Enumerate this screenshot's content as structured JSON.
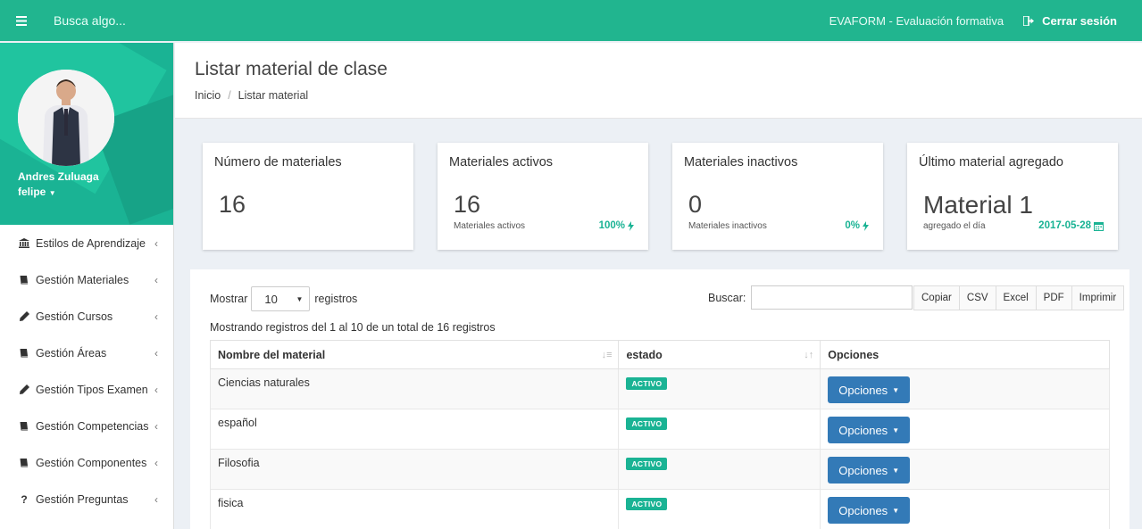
{
  "topbar": {
    "search_placeholder": "Busca algo...",
    "app_title": "EVAFORM - Evaluación formativa",
    "logout_label": "Cerrar sesión"
  },
  "profile": {
    "name": "Andres Zuluaga",
    "username": "felipe"
  },
  "sidebar": {
    "items": [
      {
        "label": "Estilos de Aprendizaje",
        "icon": "bank-icon"
      },
      {
        "label": "Gestión Materiales",
        "icon": "book-icon"
      },
      {
        "label": "Gestión Cursos",
        "icon": "pencil-icon"
      },
      {
        "label": "Gestión Áreas",
        "icon": "book-icon"
      },
      {
        "label": "Gestión Tipos Examen",
        "icon": "pencil-icon"
      },
      {
        "label": "Gestión Competencias",
        "icon": "book-icon"
      },
      {
        "label": "Gestión Componentes",
        "icon": "book-icon"
      },
      {
        "label": "Gestión Preguntas",
        "icon": "question-icon"
      }
    ]
  },
  "header": {
    "title": "Listar material de clase",
    "breadcrumb": [
      "Inicio",
      "Listar material"
    ]
  },
  "cards": [
    {
      "title": "Número de materiales",
      "value": "16"
    },
    {
      "title": "Materiales activos",
      "value": "16",
      "sub": "Materiales activos",
      "pct": "100%"
    },
    {
      "title": "Materiales inactivos",
      "value": "0",
      "sub": "Materiales inactivos",
      "pct": "0%"
    },
    {
      "title": "Último material agregado",
      "value": "Material 1",
      "sub": "agregado el día",
      "pct": "2017-05-28"
    }
  ],
  "table_controls": {
    "show_label": "Mostrar",
    "show_value": "10",
    "records_label": "registros",
    "search_label": "Buscar:",
    "export_buttons": [
      "Copiar",
      "CSV",
      "Excel",
      "PDF",
      "Imprimir"
    ],
    "info": "Mostrando registros del 1 al 10 de un total de 16 registros"
  },
  "table": {
    "headers": [
      "Nombre del material",
      "estado",
      "Opciones"
    ],
    "rows": [
      {
        "name": "Ciencias naturales",
        "status": "ACTIVO",
        "action": "Opciones"
      },
      {
        "name": "español",
        "status": "ACTIVO",
        "action": "Opciones"
      },
      {
        "name": "Filosofia",
        "status": "ACTIVO",
        "action": "Opciones"
      },
      {
        "name": "fisica",
        "status": "ACTIVO",
        "action": "Opciones"
      }
    ]
  },
  "colors": {
    "brand": "#1ab394",
    "primary_button": "#337ab7"
  }
}
